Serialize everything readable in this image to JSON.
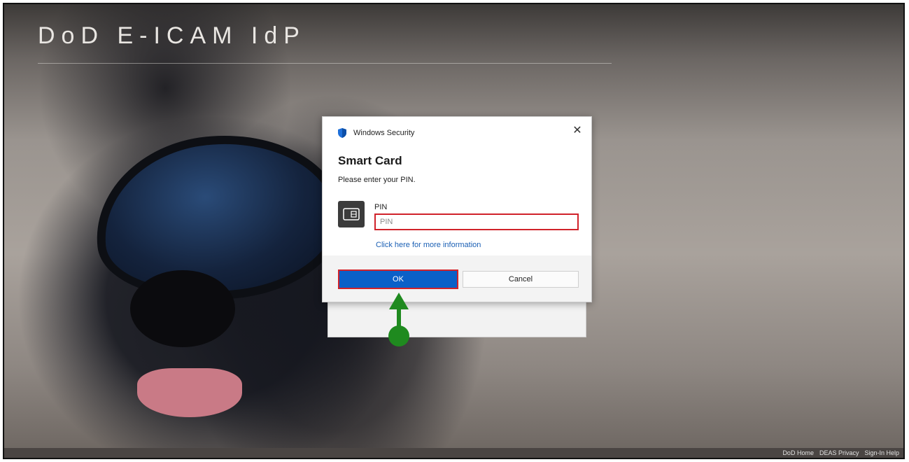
{
  "page": {
    "title": "DoD E-ICAM IdP"
  },
  "dialog": {
    "app_name": "Windows Security",
    "close_glyph": "✕",
    "title": "Smart Card",
    "message": "Please enter your PIN.",
    "pin_label": "PIN",
    "pin_placeholder": "PIN",
    "pin_value": "",
    "more_info_link": "Click here for more information",
    "ok_label": "OK",
    "cancel_label": "Cancel"
  },
  "footer": {
    "links": [
      "DoD Home",
      "DEAS Privacy",
      "Sign-In Help"
    ]
  },
  "colors": {
    "accent_blue": "#0a60c8",
    "highlight_red": "#d0222a",
    "pointer_green": "#1f8a1f",
    "link_blue": "#1a5fb4"
  },
  "icons": {
    "shield": "shield-icon",
    "smart_card": "smart-card-icon",
    "close": "close-icon",
    "pointer": "pointer-arrow-icon"
  }
}
